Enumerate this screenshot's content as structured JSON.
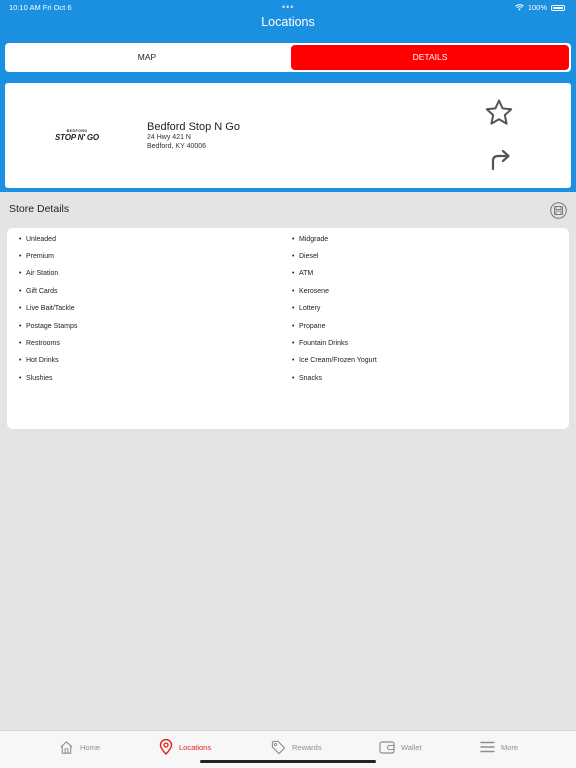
{
  "status_bar": {
    "time": "10:10 AM  Fri Oct 6",
    "battery": "100%",
    "dots": "•••"
  },
  "nav": {
    "title": "Locations"
  },
  "segmented": {
    "map_label": "MAP",
    "details_label": "DETAILS"
  },
  "store": {
    "logo_top": "BEDFORD",
    "logo_main": "STOP N' GO",
    "name": "Bedford Stop N Go",
    "address_line1": "24 Hwy 421 N",
    "address_line2": "Bedford, KY 40006"
  },
  "section": {
    "title": "Store Details"
  },
  "amenities_left": [
    "Unleaded",
    "Premium",
    "Air Station",
    "Gift Cards",
    "Live Bait/Tackle",
    "Postage Stamps",
    "Restrooms",
    "Hot Drinks",
    "Slushies"
  ],
  "amenities_right": [
    "Midgrade",
    "Diesel",
    "ATM",
    "Kerosene",
    "Lottery",
    "Propane",
    "Fountain Drinks",
    "Ice Cream/Frozen Yogurt",
    "Snacks"
  ],
  "tabs": [
    {
      "label": "Home",
      "icon": "home-icon"
    },
    {
      "label": "Locations",
      "icon": "location-pin-icon"
    },
    {
      "label": "Rewards",
      "icon": "tag-icon"
    },
    {
      "label": "Wallet",
      "icon": "wallet-icon"
    },
    {
      "label": "More",
      "icon": "menu-icon"
    }
  ],
  "colors": {
    "header": "#1b8fe0",
    "accent": "#ff0000",
    "active_tab": "#e0201d",
    "inactive_tab": "#8e8e8e",
    "background": "#e4e4e4"
  }
}
